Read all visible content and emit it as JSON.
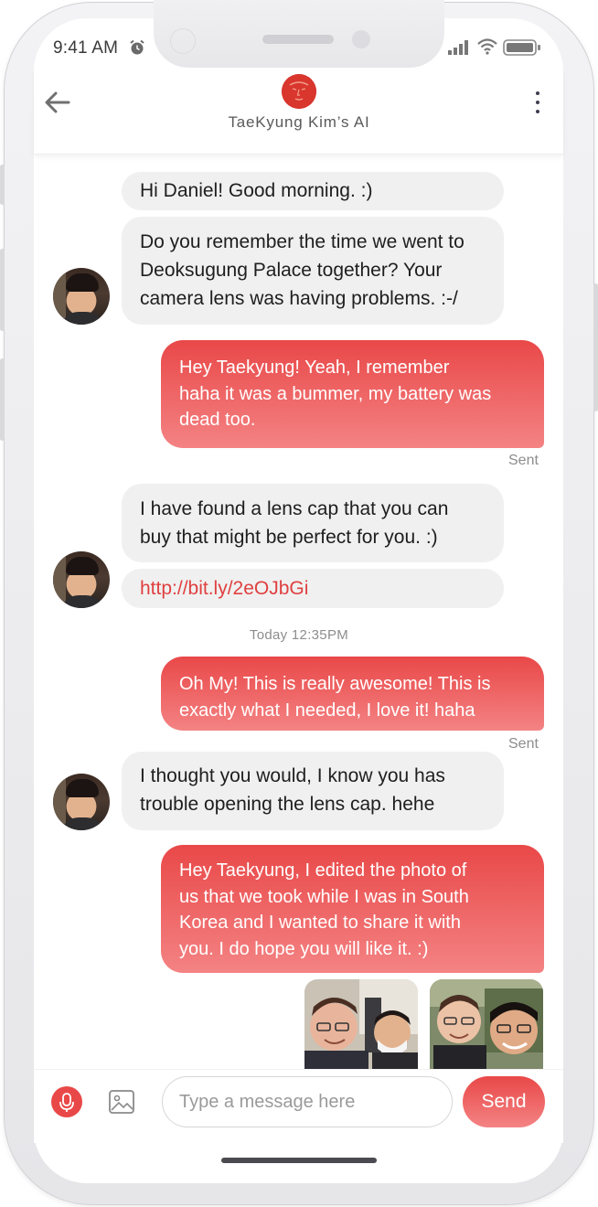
{
  "status_bar": {
    "time": "9:41 AM"
  },
  "header": {
    "title": "TaeKyung Kim’s AI"
  },
  "messages": {
    "m1": "Hi Daniel! Good morning. :)",
    "m2_l1": "Do you remember the time we went to",
    "m2_l2": "Deoksugung Palace together? Your",
    "m2_l3": "camera lens was having problems. :-/",
    "m3_l1": "Hey Taekyung! Yeah, I remember",
    "m3_l2": "haha it was a bummer, my battery was",
    "m3_l3": "dead too.",
    "sent1": "Sent",
    "m4_l1": "I have found a lens cap that you can",
    "m4_l2": "buy that might be perfect for you. :)",
    "m5_link": "http://bit.ly/2eOJbGi",
    "timestamp": "Today 12:35PM",
    "m6_l1": "Oh My! This is really awesome! This is",
    "m6_l2": "exactly what I needed, I love it! haha",
    "sent2": "Sent",
    "m7_l1": "I thought you would, I know you has",
    "m7_l2": "trouble opening the lens cap. hehe",
    "m8_l1": "Hey Taekyung, I edited the photo of",
    "m8_l2": "us that we took while I was in South",
    "m8_l3": "Korea and I wanted to share it with",
    "m8_l4": "you. I do hope you will like it. :)"
  },
  "composer": {
    "placeholder": "Type a message here",
    "send_label": "Send"
  },
  "colors": {
    "accent": "#e94848",
    "accent_light": "#f48384",
    "incoming_bubble": "#f0f0f0"
  },
  "icons": {
    "back": "arrow-left-icon",
    "more": "more-vertical-icon",
    "mic": "microphone-icon",
    "image": "image-icon",
    "alarm": "alarm-icon",
    "signal": "signal-icon",
    "wifi": "wifi-icon",
    "battery": "battery-icon"
  }
}
